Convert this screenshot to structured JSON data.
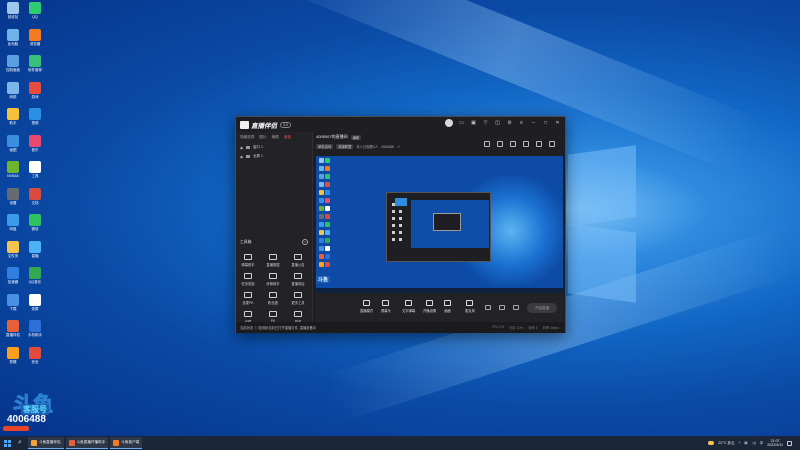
{
  "desktop": {
    "icons": [
      {
        "label": "回收站",
        "color": "#9fc7ec"
      },
      {
        "label": "QQ",
        "color": "#2ecc71"
      },
      {
        "label": "此电脑",
        "color": "#6fb3e8"
      },
      {
        "label": "浏览器",
        "color": "#f47b20"
      },
      {
        "label": "控制面板",
        "color": "#5aa0e0"
      },
      {
        "label": "软件管家",
        "color": "#36c07a"
      },
      {
        "label": "网络",
        "color": "#7bb7ea"
      },
      {
        "label": "游戏",
        "color": "#e74c3c"
      },
      {
        "label": "助手",
        "color": "#f5c03a"
      },
      {
        "label": "视频",
        "color": "#2b8fe5"
      },
      {
        "label": "画图",
        "color": "#3c8ee0"
      },
      {
        "label": "音乐",
        "color": "#e84a6f"
      },
      {
        "label": "NVIDIA",
        "color": "#6cb52d"
      },
      {
        "label": "工具",
        "color": "#ffffff"
      },
      {
        "label": "设置",
        "color": "#666b73"
      },
      {
        "label": "文档",
        "color": "#d94b3f"
      },
      {
        "label": "网盘",
        "color": "#3a9be8"
      },
      {
        "label": "微信",
        "color": "#2dc160"
      },
      {
        "label": "文件夹",
        "color": "#f3c350"
      },
      {
        "label": "直播",
        "color": "#4bb3f5"
      },
      {
        "label": "加速器",
        "color": "#2f7fe0"
      },
      {
        "label": "QQ音乐",
        "color": "#32a852"
      },
      {
        "label": "下载",
        "color": "#4a90e2"
      },
      {
        "label": "录屏",
        "color": "#ffffff"
      },
      {
        "label": "直播伴侣",
        "color": "#e85d3a"
      },
      {
        "label": "手机助手",
        "color": "#2d6fd6"
      },
      {
        "label": "剪辑",
        "color": "#ff9f1a"
      },
      {
        "label": "安全",
        "color": "#e24a3b"
      }
    ],
    "promo": {
      "brand": "斗鱼",
      "sub": "客服号",
      "number": "4006488"
    }
  },
  "app": {
    "name": "直播伴侣",
    "version": "3.0",
    "left_tabs": [
      "场景选择",
      "图片",
      "美颜",
      "添加"
    ],
    "sources": [
      "窗口 1",
      "全屏 1"
    ],
    "tools_title": "工具箱",
    "tools_help": "?",
    "tools": [
      {
        "label": "弹幕助手"
      },
      {
        "label": "直播数据"
      },
      {
        "label": "直播公告"
      },
      {
        "label": "任务奖励"
      },
      {
        "label": "房管助手"
      },
      {
        "label": "直播商店"
      },
      {
        "label": "连麦PK"
      },
      {
        "label": "粉丝团"
      },
      {
        "label": "更多工具"
      },
      {
        "label": "滤镜"
      },
      {
        "label": "PK"
      },
      {
        "label": "抽奖"
      }
    ],
    "room_title": "4005007的直播间",
    "room_edit": "编辑",
    "meta": {
      "chip1": "单机游戏",
      "chip2": "英雄联盟",
      "viewers": "本人已观看0人",
      "follow": "4005488"
    },
    "controls": [
      {
        "label": "直播模式"
      },
      {
        "label": "屏幕头"
      },
      {
        "label": "文字弹幕"
      },
      {
        "label": "开播设置"
      },
      {
        "label": "画面"
      },
      {
        "label": "麦克风"
      }
    ],
    "go_live": "开始直播",
    "footer": {
      "left": "当前状态 ⓘ 检测到当前已打开直播文件, 直播准备中",
      "right": [
        "CPU 0%",
        "内存 30%",
        "帧率 0",
        "码率 0kbps"
      ]
    }
  },
  "taskbar": {
    "apps": [
      {
        "label": "斗鱼直播伴侣",
        "color": "#f4a23a"
      },
      {
        "label": "斗鱼直播开播助手",
        "color": "#e85d3a"
      },
      {
        "label": "斗鱼客户端",
        "color": "#f47b20"
      }
    ],
    "weather": "22°C 多云",
    "ime": "中",
    "time": "21:07",
    "date": "2022/4/11"
  }
}
